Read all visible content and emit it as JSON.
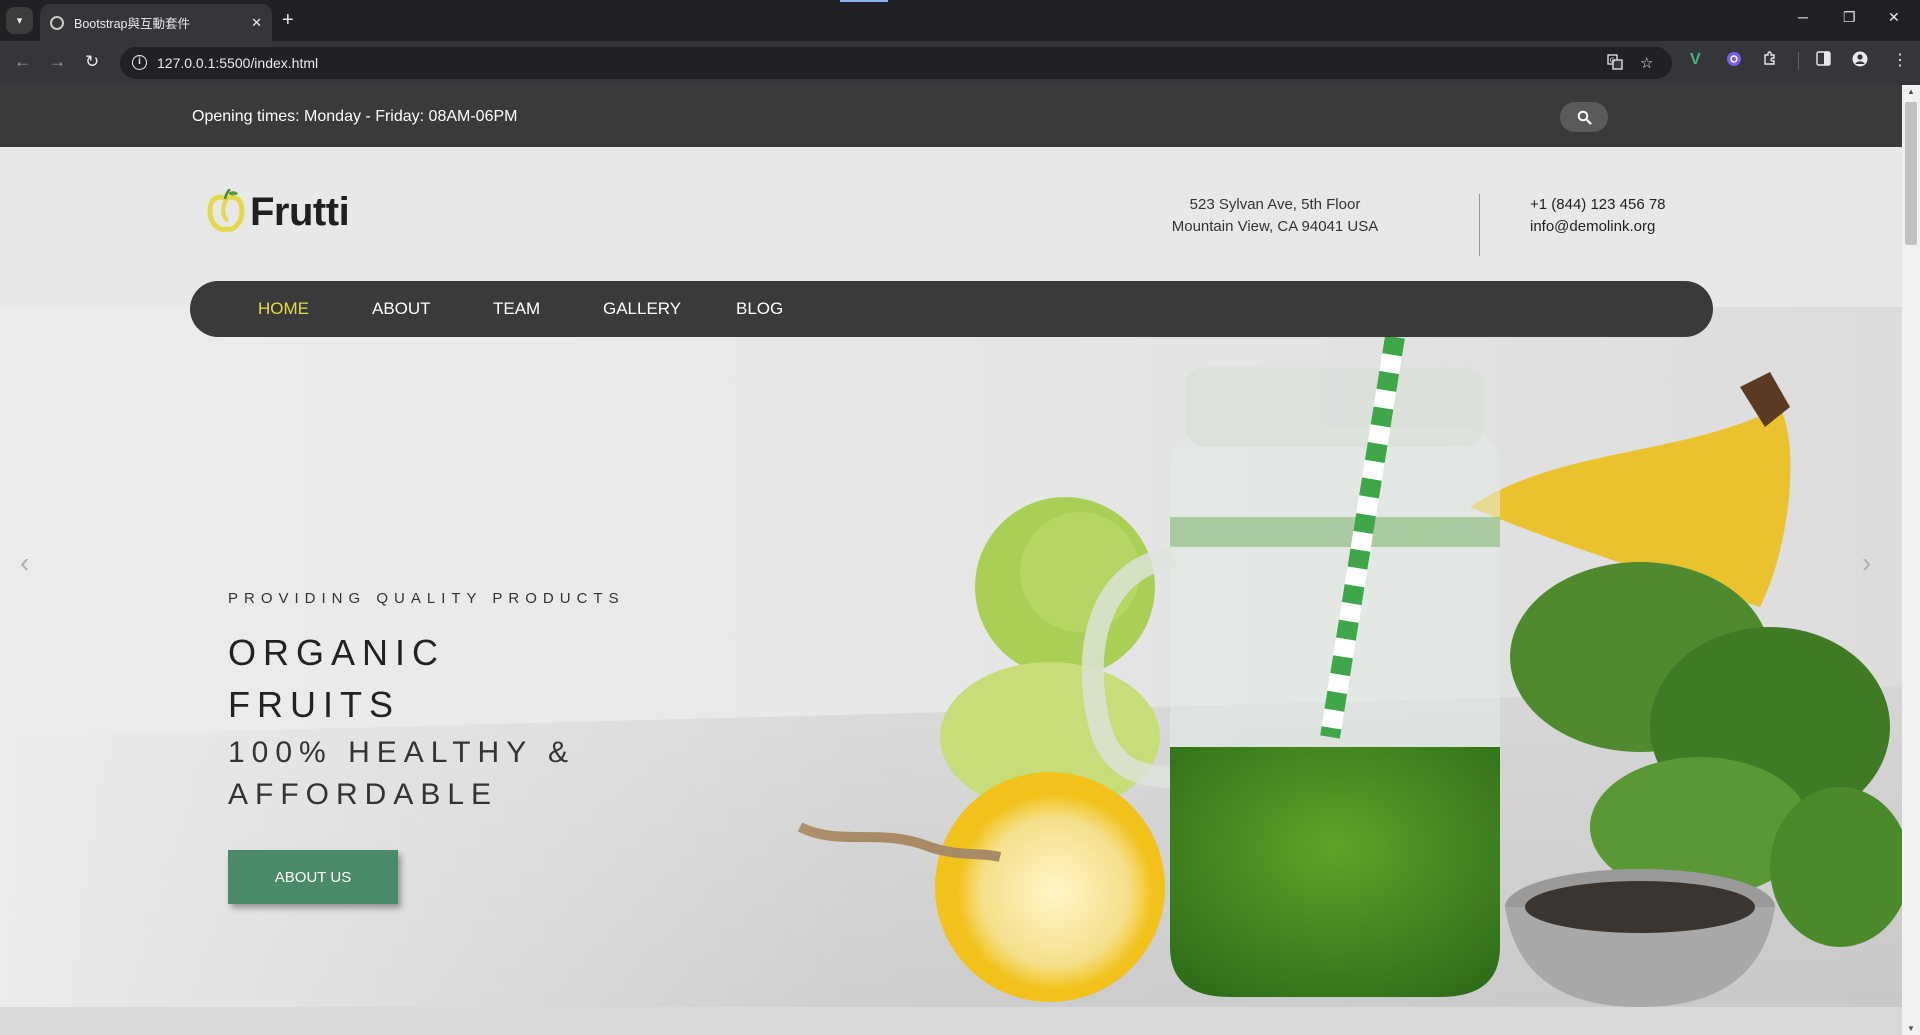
{
  "browser": {
    "tab_title": "Bootstrap與互動套件",
    "url": "127.0.0.1:5500/index.html",
    "new_tab": "+",
    "tab_close": "✕",
    "icons": [
      "tab-search-icon",
      "back-icon",
      "forward-icon",
      "reload-icon",
      "site-info-icon",
      "translate-icon",
      "bookmark-star-icon",
      "vue-devtools-icon",
      "extension-icon",
      "puzzle-icon",
      "side-panel-icon",
      "profile-icon",
      "menu-icon",
      "minimize-icon",
      "restore-icon",
      "close-window-icon"
    ]
  },
  "topbar": {
    "hours": "Opening times: Monday - Friday: 08AM-06PM"
  },
  "header": {
    "logo_text": "Frutti",
    "address_line1": "523 Sylvan Ave, 5th Floor",
    "address_line2": "Mountain View, CA 94041 USA",
    "phone": "+1 (844) 123 456 78",
    "email": "info@demolink.org"
  },
  "nav": {
    "items": [
      {
        "label": "HOME",
        "active": true
      },
      {
        "label": "ABOUT",
        "active": false
      },
      {
        "label": "TEAM",
        "active": false
      },
      {
        "label": "GALLERY",
        "active": false
      },
      {
        "label": "BLOG",
        "active": false
      }
    ]
  },
  "hero": {
    "kicker": "PROVIDING QUALITY PRODUCTS",
    "title_line1": "ORGANIC",
    "title_line2": "FRUITS",
    "subtitle_line1": "100% HEALTHY &",
    "subtitle_line2": "AFFORDABLE",
    "cta": "ABOUT US",
    "prev": "‹",
    "next": "›"
  },
  "colors": {
    "accent_green": "#4a8a69",
    "nav_active": "#e8d84a",
    "dark_bar": "#3a3a3a"
  }
}
